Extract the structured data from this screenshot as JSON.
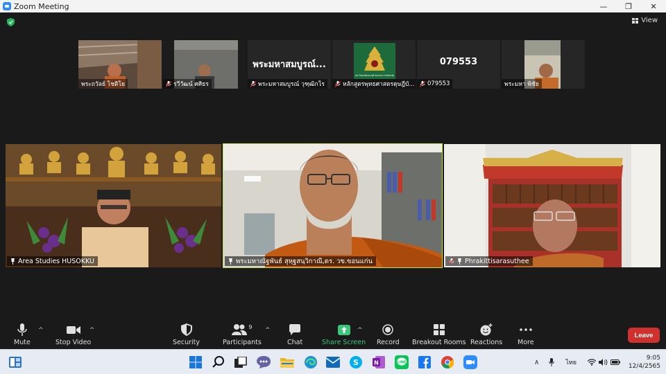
{
  "window": {
    "title": "Zoom Meeting",
    "minimize": "—",
    "maximize": "❐",
    "close": "✕"
  },
  "view": {
    "label": "View"
  },
  "thumbnails": [
    {
      "name": "พระถวัลย์ โชติโย",
      "muted": false,
      "big_name": ""
    },
    {
      "name": "รวีวัฒน์ ศศิธร",
      "muted": true,
      "big_name": ""
    },
    {
      "name": "พระมหาสมบูรณ์ วุฑฺฒิกโร",
      "muted": true,
      "big_name": "พระมหาสมบูรณ์..."
    },
    {
      "name": "หลักสูตรพุทธศาสตรดุษฎีบั...",
      "muted": true,
      "big_name": ""
    },
    {
      "name": "079553",
      "muted": true,
      "big_name": "079553"
    },
    {
      "name": "พระมหา พิชัย",
      "muted": false,
      "big_name": ""
    }
  ],
  "logo_caption": "มหาวิทยาลัยมหาจุฬาลงกรณราชวิทยาลัย",
  "tiles": [
    {
      "name": "Area Studies HUSOKKU",
      "muted": false,
      "pinned": true
    },
    {
      "name": "พระมหาณัฐพันธ์ สุหฺฐสนฺวิกาณี,ดร. วข.ขอนแก่น",
      "muted": false,
      "pinned": true
    },
    {
      "name": "Phrakittisarasuthee",
      "muted": true,
      "pinned": true
    }
  ],
  "toolbar": {
    "mute": "Mute",
    "stop_video": "Stop Video",
    "security": "Security",
    "participants": "Participants",
    "participants_count": "9",
    "chat": "Chat",
    "share_screen": "Share Screen",
    "record": "Record",
    "breakout_rooms": "Breakout Rooms",
    "reactions": "Reactions",
    "more": "More",
    "leave": "Leave"
  },
  "taskbar": {
    "icons": [
      "widgets-icon",
      "windows-start-icon",
      "search-icon",
      "task-view-icon",
      "teams-chat-icon",
      "file-explorer-icon",
      "edge-icon",
      "mail-icon",
      "skype-icon",
      "onenote-icon",
      "line-icon",
      "facebook-icon",
      "chrome-icon",
      "zoom-icon"
    ],
    "language": "ไทย",
    "time": "9:05",
    "date": "12/4/2565"
  },
  "colors": {
    "accent": "#2d8cff",
    "active_speaker": "#c8e04a",
    "leave": "#d0312d",
    "share": "#3ac77a"
  }
}
